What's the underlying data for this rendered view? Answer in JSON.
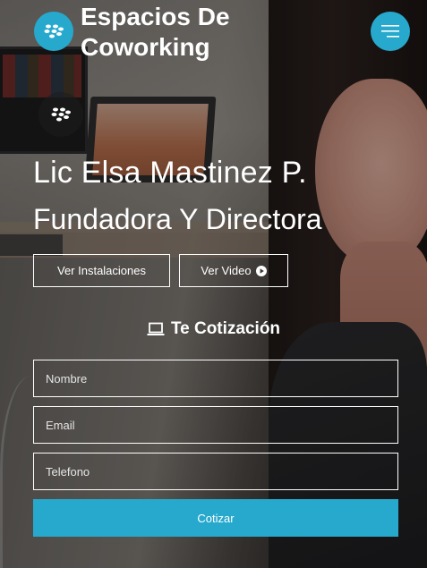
{
  "header": {
    "brand_title": "Espacios De Coworking",
    "logo_icon": "blackberry-icon",
    "menu_icon": "hamburger-menu-icon"
  },
  "hero": {
    "name": "Lic Elsa Mastinez P.",
    "role": "Fundadora Y Directora",
    "btn_instalaciones": "Ver Instalaciones",
    "btn_video": "Ver Video"
  },
  "quote": {
    "title": "Te Cotización",
    "nombre_placeholder": "Nombre",
    "email_placeholder": "Email",
    "telefono_placeholder": "Telefono",
    "submit_label": "Cotizar"
  },
  "colors": {
    "accent": "#26a9cd",
    "text": "#ffffff"
  }
}
